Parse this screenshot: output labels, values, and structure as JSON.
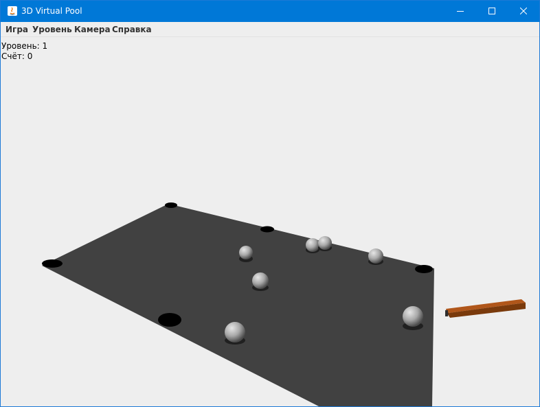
{
  "window": {
    "title": "3D Virtual Pool",
    "controls": {
      "minimize_icon": "minimize-icon",
      "maximize_icon": "maximize-icon",
      "close_icon": "close-icon"
    }
  },
  "menu": {
    "items": [
      {
        "label": "Игра"
      },
      {
        "label": "Уровень"
      },
      {
        "label": "Камера"
      },
      {
        "label": "Справка"
      }
    ]
  },
  "hud": {
    "level": "Уровень: 1",
    "score": "Счёт: 0"
  },
  "scene": {
    "table_color": "#414141",
    "pocket_color": "#000000",
    "ball_color": "#a9a9a9",
    "cue_color": "#9a4a12",
    "background_color": "#eeeeee"
  }
}
